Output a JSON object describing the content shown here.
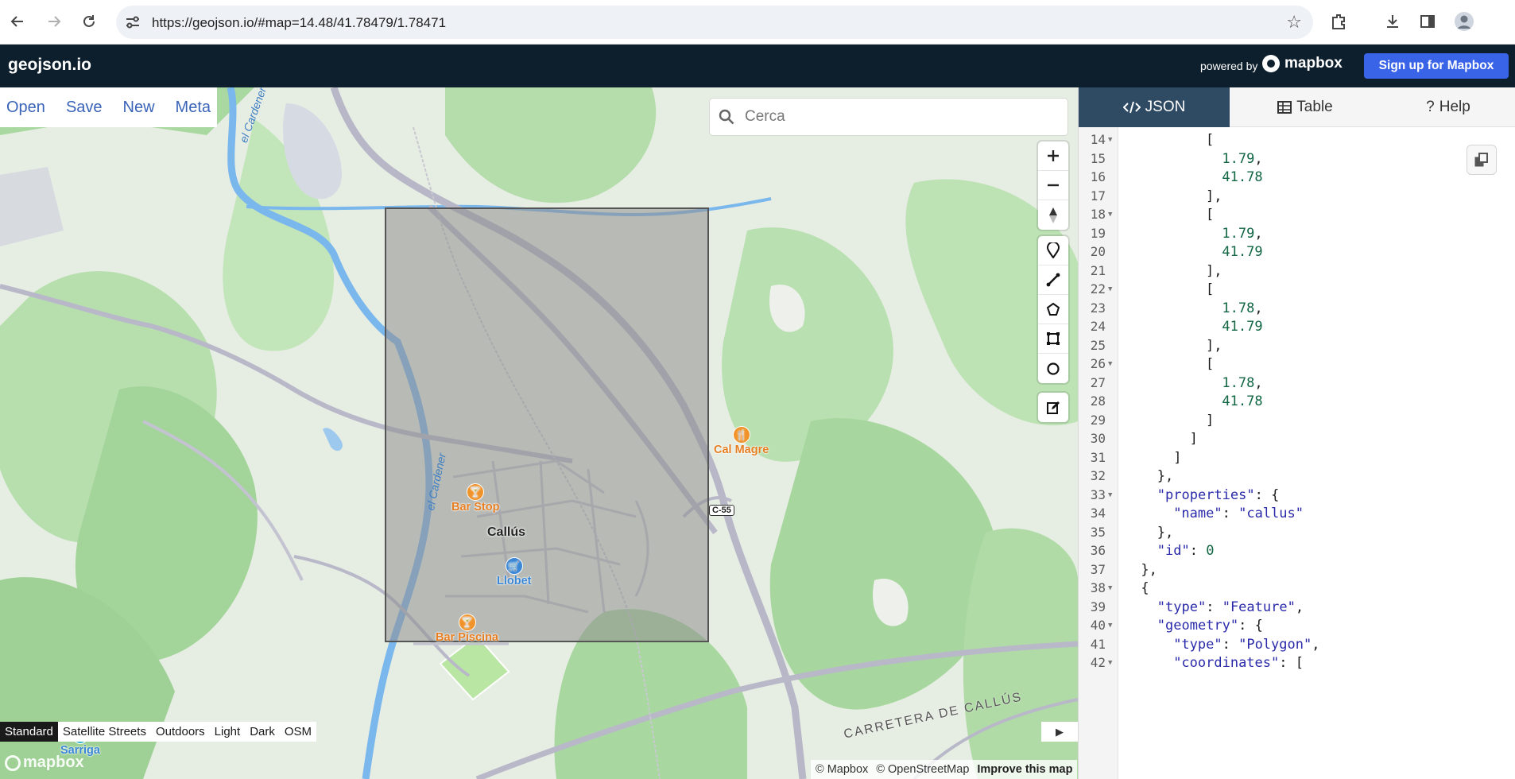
{
  "browser": {
    "url": "https://geojson.io/#map=14.48/41.78479/1.78471",
    "icons": [
      "back-icon",
      "forward-icon",
      "reload-icon",
      "site-settings-icon",
      "bookmark-star-icon",
      "extensions-icon",
      "download-icon",
      "side-panel-icon",
      "profile-avatar"
    ]
  },
  "app": {
    "brand": "geojson.io",
    "powered_by": "powered by",
    "mapbox_logo": "mapbox",
    "signup": "Sign up for Mapbox"
  },
  "file_menu": {
    "open": "Open",
    "save": "Save",
    "new": "New",
    "meta": "Meta"
  },
  "search": {
    "placeholder": "Cerca"
  },
  "map_labels": {
    "town": "Callús",
    "poi_bar_stop": "Bar Stop",
    "poi_llobet": "Llobet",
    "poi_bar_piscina": "Bar Piscina",
    "poi_cal_magre": "Cal Magre",
    "shield": "C-55",
    "road": "CARRETERA DE CALLÚS",
    "river_1": "el Cardener",
    "river_2": "el Cardener",
    "bottom_poi": "Sarriga"
  },
  "map_styles": [
    "Standard",
    "Satellite Streets",
    "Outdoors",
    "Light",
    "Dark",
    "OSM"
  ],
  "map_styles_active": "Standard",
  "attribution": {
    "mapbox": "© Mapbox",
    "osm": "© OpenStreetMap",
    "improve": "Improve this map"
  },
  "watermark": "mapbox",
  "tabs": {
    "json": "JSON",
    "table": "Table",
    "help": "Help",
    "active": "JSON"
  },
  "editor_lines": [
    {
      "n": "14",
      "fold": true,
      "indent": 10,
      "text": "["
    },
    {
      "n": "15",
      "fold": false,
      "indent": 12,
      "num": "1.79",
      "suffix": ","
    },
    {
      "n": "16",
      "fold": false,
      "indent": 12,
      "num": "41.78"
    },
    {
      "n": "17",
      "fold": false,
      "indent": 10,
      "text": "],"
    },
    {
      "n": "18",
      "fold": true,
      "indent": 10,
      "text": "["
    },
    {
      "n": "19",
      "fold": false,
      "indent": 12,
      "num": "1.79",
      "suffix": ","
    },
    {
      "n": "20",
      "fold": false,
      "indent": 12,
      "num": "41.79"
    },
    {
      "n": "21",
      "fold": false,
      "indent": 10,
      "text": "],"
    },
    {
      "n": "22",
      "fold": true,
      "indent": 10,
      "text": "["
    },
    {
      "n": "23",
      "fold": false,
      "indent": 12,
      "num": "1.78",
      "suffix": ","
    },
    {
      "n": "24",
      "fold": false,
      "indent": 12,
      "num": "41.79"
    },
    {
      "n": "25",
      "fold": false,
      "indent": 10,
      "text": "],"
    },
    {
      "n": "26",
      "fold": true,
      "indent": 10,
      "text": "["
    },
    {
      "n": "27",
      "fold": false,
      "indent": 12,
      "num": "1.78",
      "suffix": ","
    },
    {
      "n": "28",
      "fold": false,
      "indent": 12,
      "num": "41.78"
    },
    {
      "n": "29",
      "fold": false,
      "indent": 10,
      "text": "]"
    },
    {
      "n": "30",
      "fold": false,
      "indent": 8,
      "text": "]"
    },
    {
      "n": "31",
      "fold": false,
      "indent": 6,
      "text": "]"
    },
    {
      "n": "32",
      "fold": false,
      "indent": 4,
      "text": "},"
    },
    {
      "n": "33",
      "fold": true,
      "indent": 4,
      "key": "\"properties\"",
      "text": ": {"
    },
    {
      "n": "34",
      "fold": false,
      "indent": 6,
      "key": "\"name\"",
      "text": ": ",
      "str": "\"callus\""
    },
    {
      "n": "35",
      "fold": false,
      "indent": 4,
      "text": "},"
    },
    {
      "n": "36",
      "fold": false,
      "indent": 4,
      "key": "\"id\"",
      "text": ": ",
      "num": "0"
    },
    {
      "n": "37",
      "fold": false,
      "indent": 2,
      "text": "},"
    },
    {
      "n": "38",
      "fold": true,
      "indent": 2,
      "text": "{"
    },
    {
      "n": "39",
      "fold": false,
      "indent": 4,
      "key": "\"type\"",
      "text": ": ",
      "str": "\"Feature\"",
      "suffix": ","
    },
    {
      "n": "40",
      "fold": true,
      "indent": 4,
      "key": "\"geometry\"",
      "text": ": {"
    },
    {
      "n": "41",
      "fold": false,
      "indent": 6,
      "key": "\"type\"",
      "text": ": ",
      "str": "\"Polygon\"",
      "suffix": ","
    },
    {
      "n": "42",
      "fold": true,
      "indent": 6,
      "key": "\"coordinates\"",
      "text": ": ["
    }
  ],
  "colors": {
    "appbar": "#0d1f2c",
    "signup": "#3a64e8",
    "tab_active": "#2f4a63",
    "number_token": "#116644",
    "key_token": "#2a2aaa",
    "selection_fill": "#8f8f8f"
  }
}
